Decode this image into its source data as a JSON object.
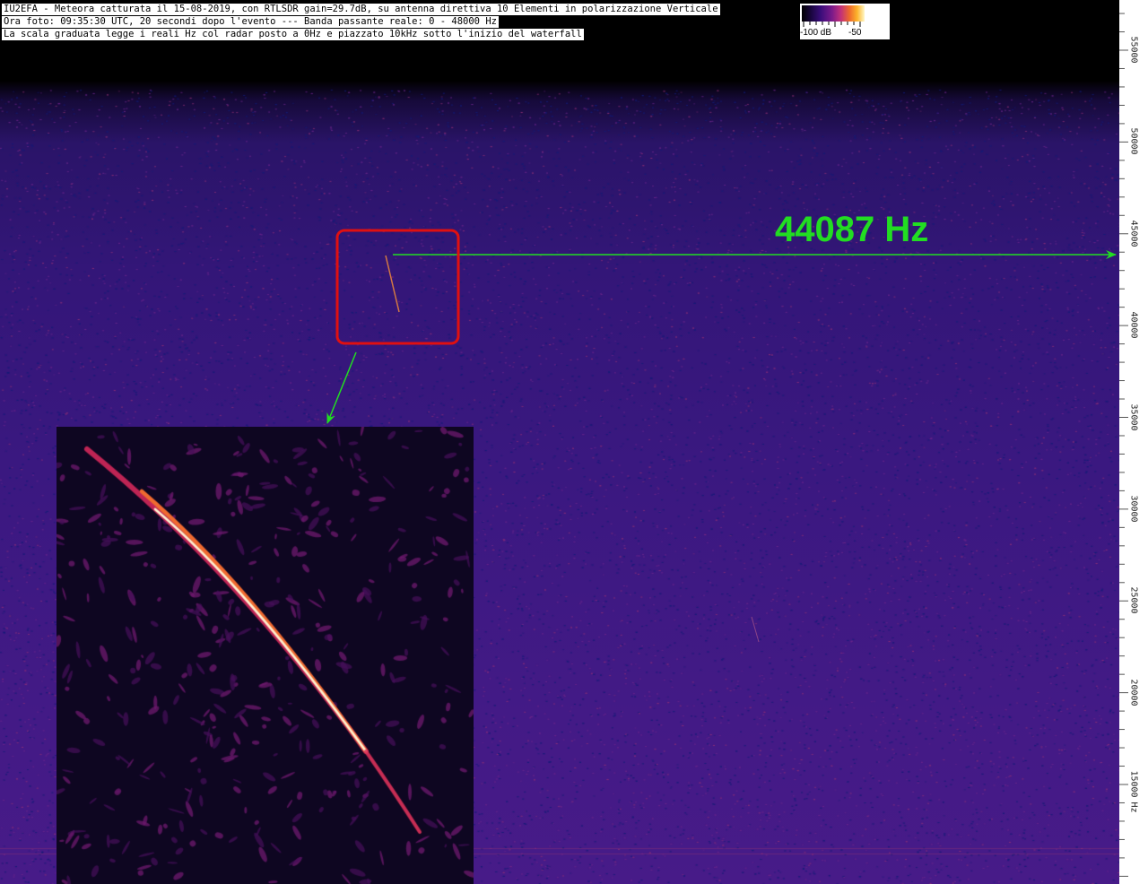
{
  "header": {
    "line1": "IU2EFA - Meteora catturata il 15-08-2019, con RTLSDR gain=29.7dB, su antenna direttiva 10 Elementi in polarizzazione Verticale",
    "line2": "Ora foto: 09:35:30 UTC, 20 secondi dopo l'evento --- Banda passante reale: 0 - 48000 Hz",
    "line3": "La scala graduata legge i reali Hz col radar posto a 0Hz e piazzato 10kHz sotto l'inizio del waterfall"
  },
  "legend": {
    "low_label": "-100 dB",
    "high_label": "-50"
  },
  "annotation": {
    "frequency_label": "44087 Hz",
    "arrow_color": "#22dd22",
    "box_color": "#e01010"
  },
  "scale": {
    "unit": "Hz",
    "labels": [
      "55000",
      "50000",
      "45000",
      "40000",
      "35000",
      "30000",
      "25000",
      "20000",
      "15000"
    ]
  },
  "colors": {
    "waterfall_bg": "#3a1880",
    "header_bg": "#ffffff"
  }
}
